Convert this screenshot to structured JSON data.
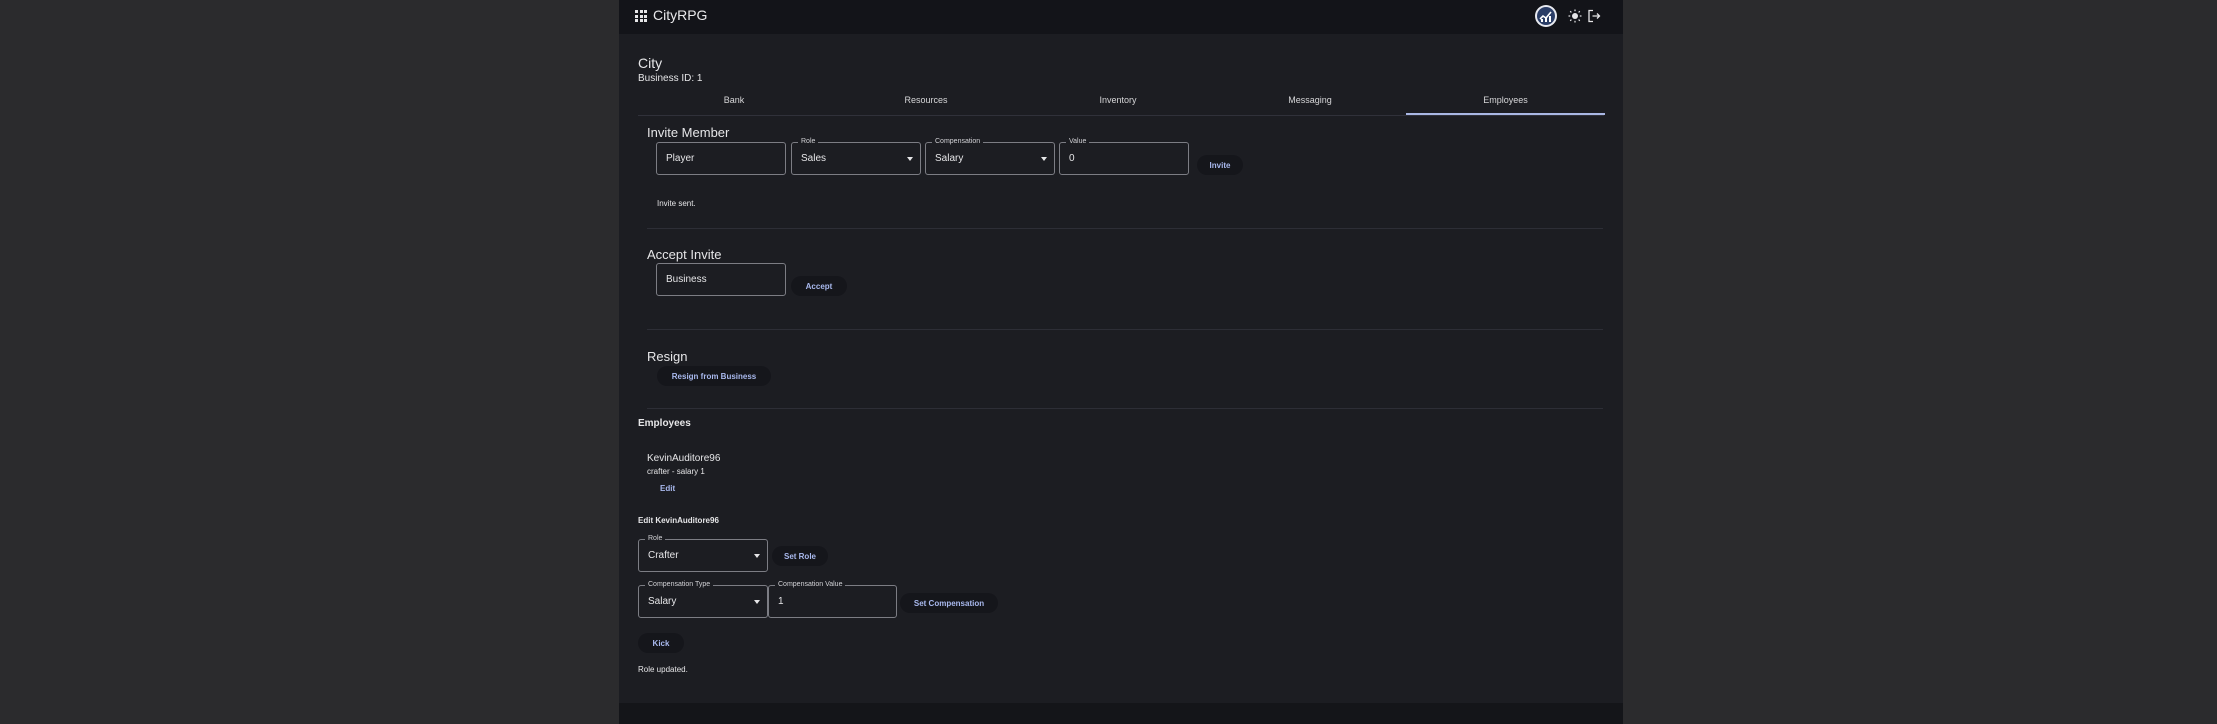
{
  "app": {
    "title": "CityRPG",
    "header_icons": [
      "grid-menu-icon",
      "avatar-badge-icon",
      "sun-icon",
      "logout-icon"
    ]
  },
  "page": {
    "title": "City",
    "business_id": "Business ID: 1"
  },
  "tabs": [
    {
      "label": "Bank",
      "selected": false
    },
    {
      "label": "Resources",
      "selected": false
    },
    {
      "label": "Inventory",
      "selected": false
    },
    {
      "label": "Messaging",
      "selected": false
    },
    {
      "label": "Employees",
      "selected": true
    }
  ],
  "invite": {
    "heading": "Invite Member",
    "player_value": "Player",
    "role_label": "Role",
    "role_value": "Sales",
    "compensation_label": "Compensation",
    "compensation_value": "Salary",
    "value_label": "Value",
    "value_value": "0",
    "invite_button": "Invite",
    "status": "Invite sent."
  },
  "accept": {
    "heading": "Accept Invite",
    "business_value": "Business",
    "accept_button": "Accept"
  },
  "resign": {
    "heading": "Resign",
    "button": "Resign from Business"
  },
  "employees": {
    "heading": "Employees",
    "list": [
      {
        "name": "KevinAuditore96",
        "detail": "crafter - salary 1",
        "edit_label": "Edit"
      }
    ]
  },
  "edit": {
    "heading": "Edit KevinAuditore96",
    "role_label": "Role",
    "role_value": "Crafter",
    "set_role_button": "Set Role",
    "comp_type_label": "Compensation Type",
    "comp_type_value": "Salary",
    "comp_value_label": "Compensation Value",
    "comp_value_value": "1",
    "set_comp_button": "Set Compensation",
    "kick_button": "Kick",
    "status": "Role updated."
  },
  "colors": {
    "background": "#2b2b2d",
    "surface": "#1c1d22",
    "appbar": "#131419",
    "accent": "#a9b9ee"
  }
}
